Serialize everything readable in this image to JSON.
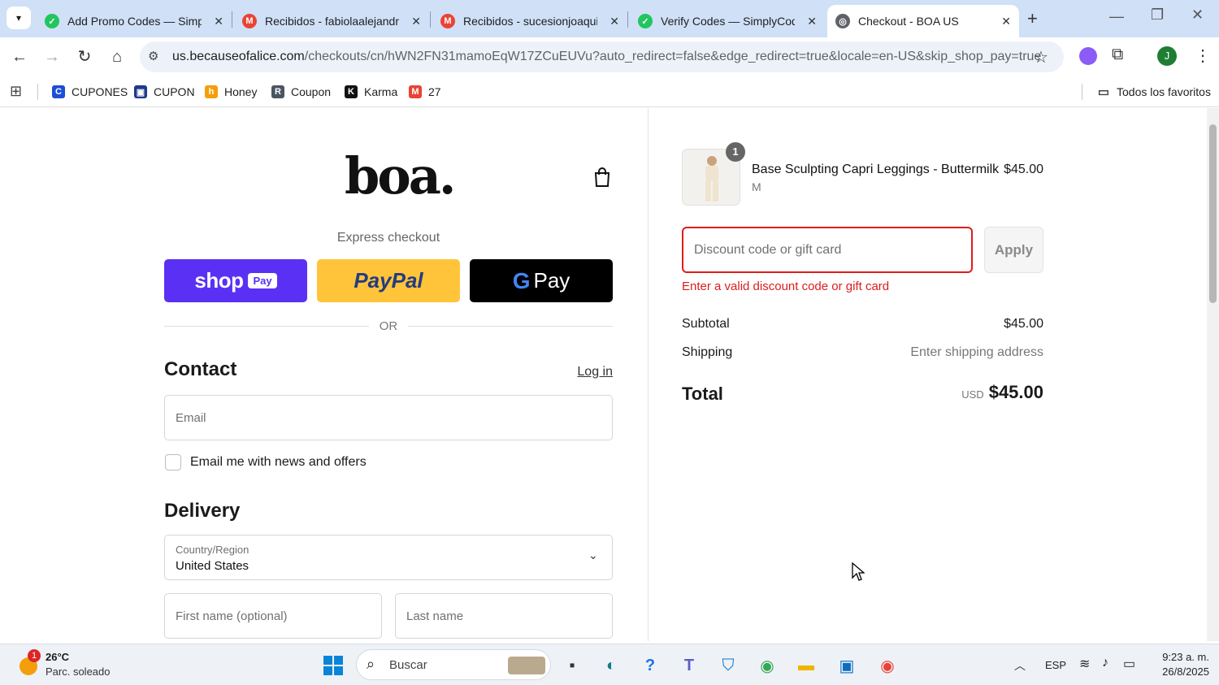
{
  "browser": {
    "tabs": [
      {
        "title": "Add Promo Codes — Simply",
        "icon_color": "#22c55e"
      },
      {
        "title": "Recibidos - fabiolaalejandria",
        "icon_color": "#ea4335"
      },
      {
        "title": "Recibidos - sucesionjoaquin",
        "icon_color": "#ea4335"
      },
      {
        "title": "Verify Codes — SimplyCode",
        "icon_color": "#22c55e"
      },
      {
        "title": "Checkout - BOA US",
        "icon_color": "#5f6368"
      }
    ],
    "url_host": "us.becauseofalice.com",
    "url_path": "/checkouts/cn/hWN2FN31mamoEqW17ZCuEUVu?auto_redirect=false&edge_redirect=true&locale=en-US&skip_shop_pay=true",
    "bookmarks": [
      "CUPONES",
      "CUPON",
      "Honey",
      "Coupon",
      "Karma",
      "27"
    ],
    "all_bookmarks": "Todos los favoritos",
    "profile_initial": "J"
  },
  "checkout": {
    "logo": "boa.",
    "express_checkout": "Express checkout",
    "shop_label": "shop",
    "shop_badge": "Pay",
    "paypal_label": "PayPal",
    "gpay_label": "Pay",
    "or": "OR",
    "contact_heading": "Contact",
    "login_link": "Log in",
    "email_placeholder": "Email",
    "news_label": "Email me with news and offers",
    "delivery_heading": "Delivery",
    "country_label": "Country/Region",
    "country_value": "United States",
    "first_name_placeholder": "First name (optional)",
    "last_name_placeholder": "Last name"
  },
  "summary": {
    "item_qty": "1",
    "item_name": "Base Sculpting Capri Leggings - Buttermilk",
    "item_variant": "M",
    "item_price": "$45.00",
    "discount_placeholder": "Discount code or gift card",
    "apply_label": "Apply",
    "error_text": "Enter a valid discount code or gift card",
    "subtotal_label": "Subtotal",
    "subtotal_value": "$45.00",
    "shipping_label": "Shipping",
    "shipping_value": "Enter shipping address",
    "total_label": "Total",
    "total_currency": "USD",
    "total_value": "$45.00",
    "error_color": "#dd1d1d"
  },
  "taskbar": {
    "weather_temp": "26°C",
    "weather_desc": "Parc. soleado",
    "weather_badge": "1",
    "search_placeholder": "Buscar",
    "lang": "ESP",
    "time": "9:23 a. m.",
    "date": "26/8/2025"
  }
}
